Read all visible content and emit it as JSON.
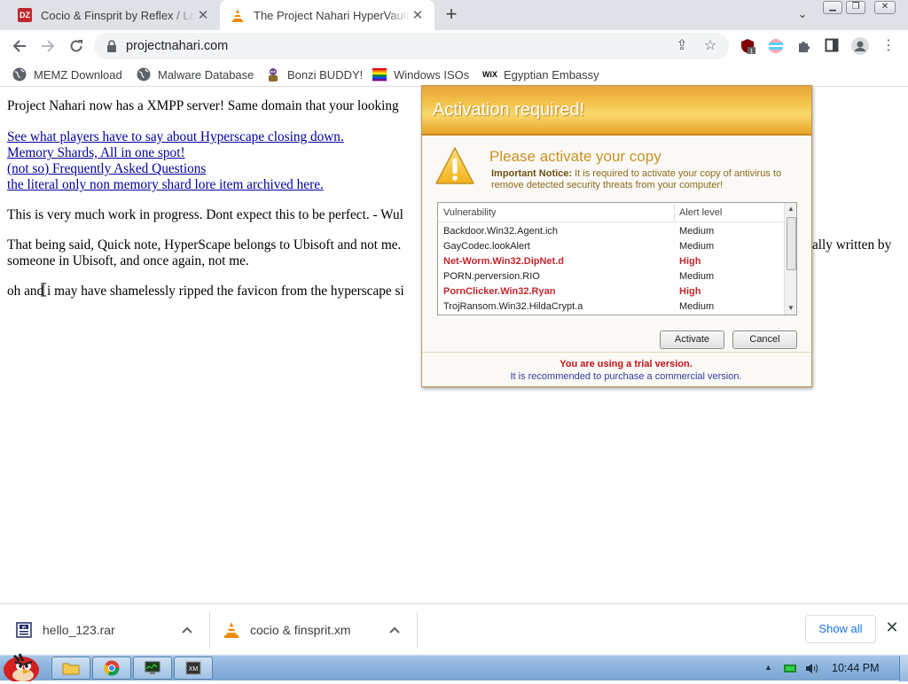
{
  "browser": {
    "tabs": [
      {
        "title": "Cocio & Finsprit by Reflex / Lo",
        "favicon_text": "DZ",
        "active": false
      },
      {
        "title": "The Project Nahari HyperVault",
        "active": true
      }
    ],
    "url": "projectnahari.com",
    "extension_badge": "1"
  },
  "bookmarks": [
    {
      "label": "MEMZ Download",
      "icon": "globe-icon"
    },
    {
      "label": "Malware Database",
      "icon": "globe-icon"
    },
    {
      "label": "Bonzi BUDDY!",
      "icon": "bonzi-icon"
    },
    {
      "label": "Windows ISOs",
      "icon": "rainbow-flag-icon"
    },
    {
      "label": "Egyptian Embassy",
      "icon": "wix-icon",
      "icon_text": "WiX"
    }
  ],
  "page": {
    "line1": "Project Nahari now has a XMPP server! Same domain that your looking",
    "links": [
      "See what players have to say about Hyperscape closing down.",
      "Memory Shards, All in one spot!",
      "(not so) Frequently Asked Questions",
      "the literal only non memory shard lore item archived here."
    ],
    "wip": "This is very much work in progress. Dont expect this to be perfect. - Wul",
    "note_a": "That being said, Quick note, HyperScape belongs to Ubisoft and not me.",
    "note_a_tail": "ally written by",
    "note_b": "someone in Ubisoft, and once again, not me.",
    "favicon_note": "oh and i may have shamelessly ripped the favicon from the hyperscape si"
  },
  "dialog": {
    "title": "Activation required!",
    "heading": "Please activate your copy",
    "notice_bold": "Important Notice:",
    "notice_text": " It is required to activate your copy of antivirus to remove detected security threats from your computer!",
    "columns": [
      "Vulnerability",
      "Alert level"
    ],
    "rows": [
      {
        "name": "Backdoor.Win32.Agent.ich",
        "level": "Medium",
        "high": false
      },
      {
        "name": "GayCodec.lookAlert",
        "level": "Medium",
        "high": false
      },
      {
        "name": "Net-Worm.Win32.DipNet.d",
        "level": "High",
        "high": true
      },
      {
        "name": "PORN.perversion.RIO",
        "level": "Medium",
        "high": false
      },
      {
        "name": "PornClicker.Win32.Ryan",
        "level": "High",
        "high": true
      },
      {
        "name": "TrojRansom.Win32.HildaCrypt.a",
        "level": "Medium",
        "high": false
      }
    ],
    "activate_label": "Activate",
    "cancel_label": "Cancel",
    "trial_line": "You are using a trial version.",
    "recommend_line": "It is recommended to purchase a commercial version."
  },
  "downloads": {
    "items": [
      {
        "name": "hello_123.rar",
        "icon": "rar-archive-icon"
      },
      {
        "name": "cocio & finsprit.xm",
        "icon": "vlc-cone-icon"
      }
    ],
    "show_all": "Show all"
  },
  "taskbar": {
    "clock": "10:44 PM"
  },
  "colors": {
    "dialog_header": "#f3c24a",
    "high_alert": "#c0272d",
    "trial_red": "#c0141a",
    "link": "#00009f"
  }
}
